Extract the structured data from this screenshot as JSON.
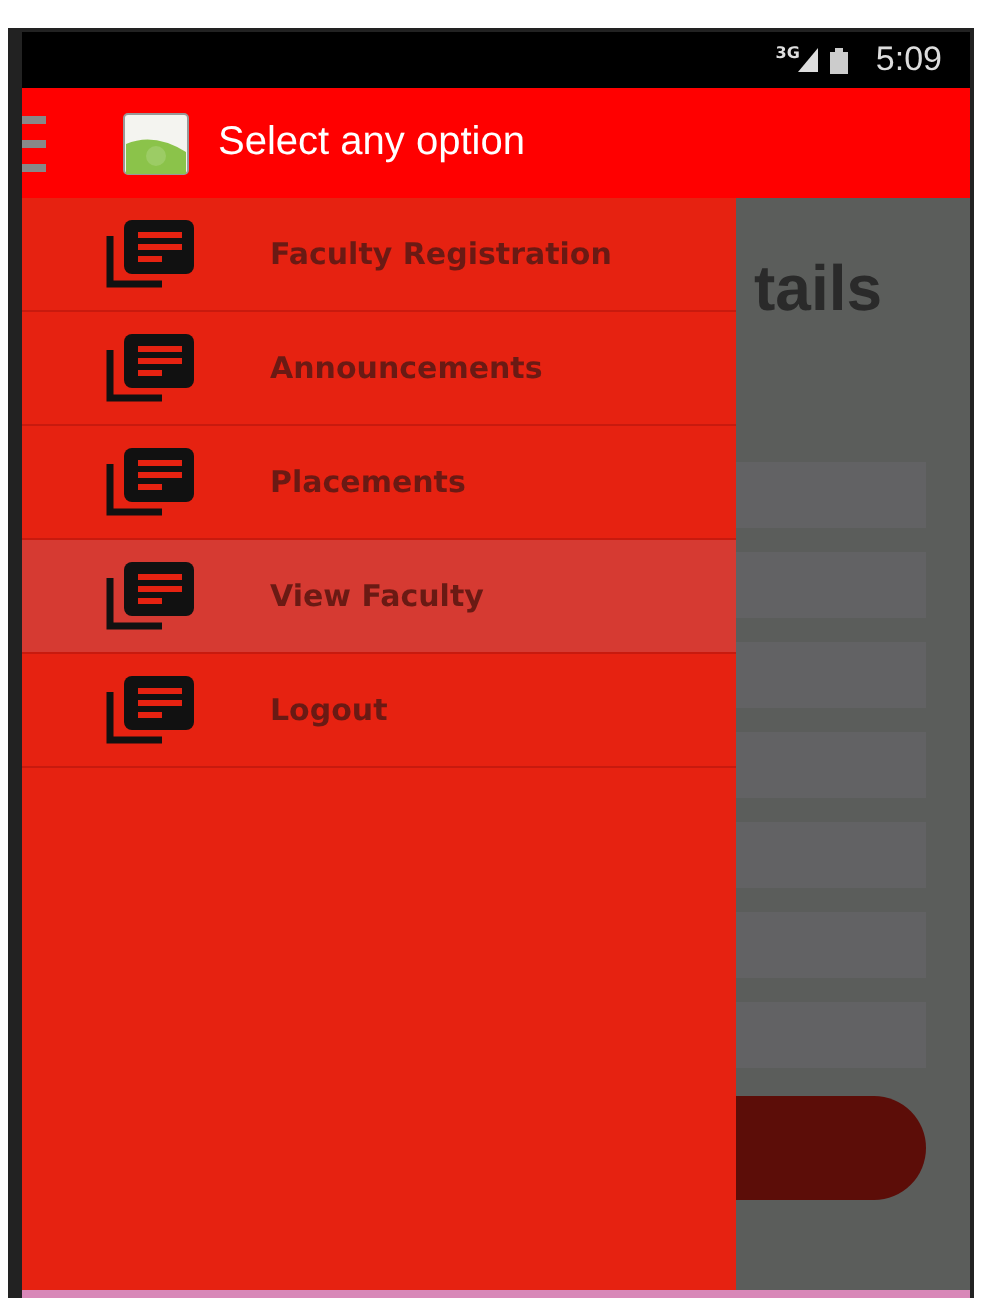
{
  "status_bar": {
    "network": "3G",
    "time": "5:09"
  },
  "app_bar": {
    "title": "Select any option"
  },
  "drawer": {
    "items": [
      {
        "label": "Faculty Registration",
        "selected": false
      },
      {
        "label": "Announcements",
        "selected": false
      },
      {
        "label": "Placements",
        "selected": false
      },
      {
        "label": "View Faculty",
        "selected": true
      },
      {
        "label": "Logout",
        "selected": false
      }
    ]
  },
  "background": {
    "heading": "tails"
  }
}
